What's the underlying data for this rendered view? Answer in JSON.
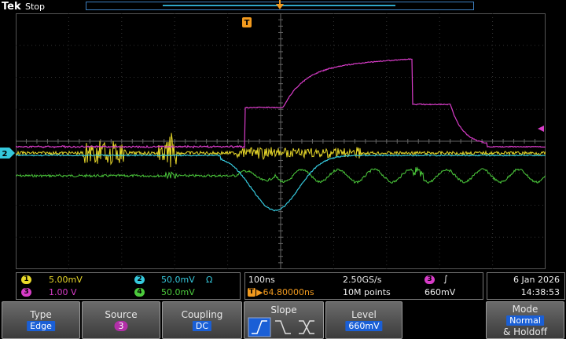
{
  "header": {
    "brand": "Tek",
    "run_state": "Stop"
  },
  "colors": {
    "ch1": "#e8d82a",
    "ch2": "#35c8dc",
    "ch3": "#d83cc8",
    "ch4": "#4ccb3c",
    "accent": "#1a5fd6",
    "trigger": "#f29a1e"
  },
  "markers": {
    "trigger_badge": "T",
    "ch2_ground": "2"
  },
  "channels": [
    {
      "id": "1",
      "scale": "5.00mV",
      "extra": ""
    },
    {
      "id": "2",
      "scale": "50.0mV",
      "extra": "Ω"
    },
    {
      "id": "3",
      "scale": "1.00 V",
      "extra": ""
    },
    {
      "id": "4",
      "scale": "50.0mV",
      "extra": ""
    }
  ],
  "timebase": {
    "scale": "100ns",
    "sample_rate": "2.50GS/s",
    "trig_pos": "▶64.80000ns",
    "record": "10M points",
    "trig_source": "3",
    "trig_slope_symbol": "∫",
    "trig_level": "660mV"
  },
  "clock": {
    "date": "6 Jan  2026",
    "time": "14:38:53"
  },
  "menu": {
    "type_label": "Type",
    "type_value": "Edge",
    "source_label": "Source",
    "source_value": "3",
    "coupling_label": "Coupling",
    "coupling_value": "DC",
    "slope_label": "Slope",
    "level_label": "Level",
    "level_value": "660mV",
    "mode_label": "Mode",
    "mode_value": "Normal",
    "mode_sub": "& Holdoff"
  }
}
